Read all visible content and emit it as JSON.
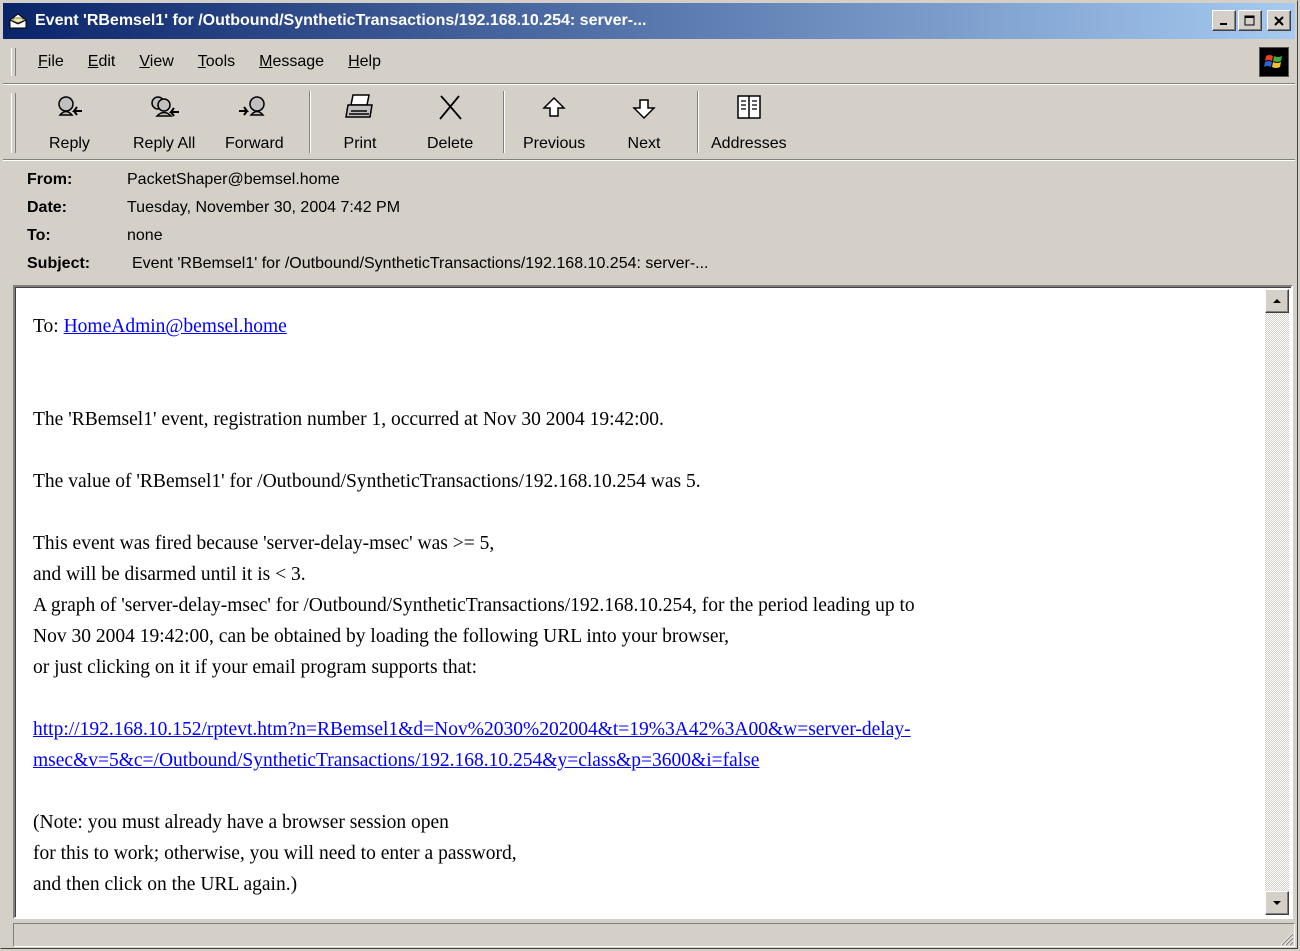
{
  "window": {
    "title": "Event 'RBemsel1' for /Outbound/SyntheticTransactions/192.168.10.254: server-..."
  },
  "menu": [
    {
      "pre": "",
      "key": "F",
      "post": "ile"
    },
    {
      "pre": "",
      "key": "E",
      "post": "dit"
    },
    {
      "pre": "",
      "key": "V",
      "post": "iew"
    },
    {
      "pre": "",
      "key": "T",
      "post": "ools"
    },
    {
      "pre": "",
      "key": "M",
      "post": "essage"
    },
    {
      "pre": "",
      "key": "H",
      "post": "elp"
    }
  ],
  "toolbar": {
    "reply": "Reply",
    "reply_all": "Reply All",
    "forward": "Forward",
    "print": "Print",
    "delete": "Delete",
    "previous": "Previous",
    "next": "Next",
    "addresses": "Addresses"
  },
  "headers": {
    "from_label": "From:",
    "from": "PacketShaper@bemsel.home",
    "date_label": "Date:",
    "date": "Tuesday, November 30, 2004 7:42 PM",
    "to_label": "To:",
    "to": "none",
    "subject_label": "Subject:",
    "subject": "Event 'RBemsel1' for /Outbound/SyntheticTransactions/192.168.10.254: server-..."
  },
  "message": {
    "to_prefix": "To: ",
    "to_link": "HomeAdmin@bemsel.home",
    "line1": "The 'RBemsel1' event, registration number 1, occurred at Nov 30 2004 19:42:00.",
    "line2": "The value of 'RBemsel1' for /Outbound/SyntheticTransactions/192.168.10.254 was 5.",
    "line3a": "This event was fired because 'server-delay-msec' was >= 5,",
    "line3b": "and will be disarmed until it is < 3.",
    "line3c": "A graph of 'server-delay-msec' for /Outbound/SyntheticTransactions/192.168.10.254, for the period leading up to",
    "line3d": "Nov 30 2004 19:42:00, can be obtained by loading the following URL into your browser,",
    "line3e": "or just clicking on it if your email program supports that:",
    "url_line1": "http://192.168.10.152/rptevt.htm?n=RBemsel1&d=Nov%2030%202004&t=19%3A42%3A00&w=server-delay-",
    "url_line2": "msec&v=5&c=/Outbound/SyntheticTransactions/192.168.10.254&y=class&p=3600&i=false",
    "note1": "(Note:  you must already have a browser session open",
    "note2": "for this to work;  otherwise, you will need to enter a password,",
    "note3": "and then click on the URL again.)"
  },
  "colors": {
    "titlebar_start": "#0a246a",
    "titlebar_end": "#a6caf0",
    "link": "#0000ff",
    "chrome": "#d4d0c8"
  }
}
